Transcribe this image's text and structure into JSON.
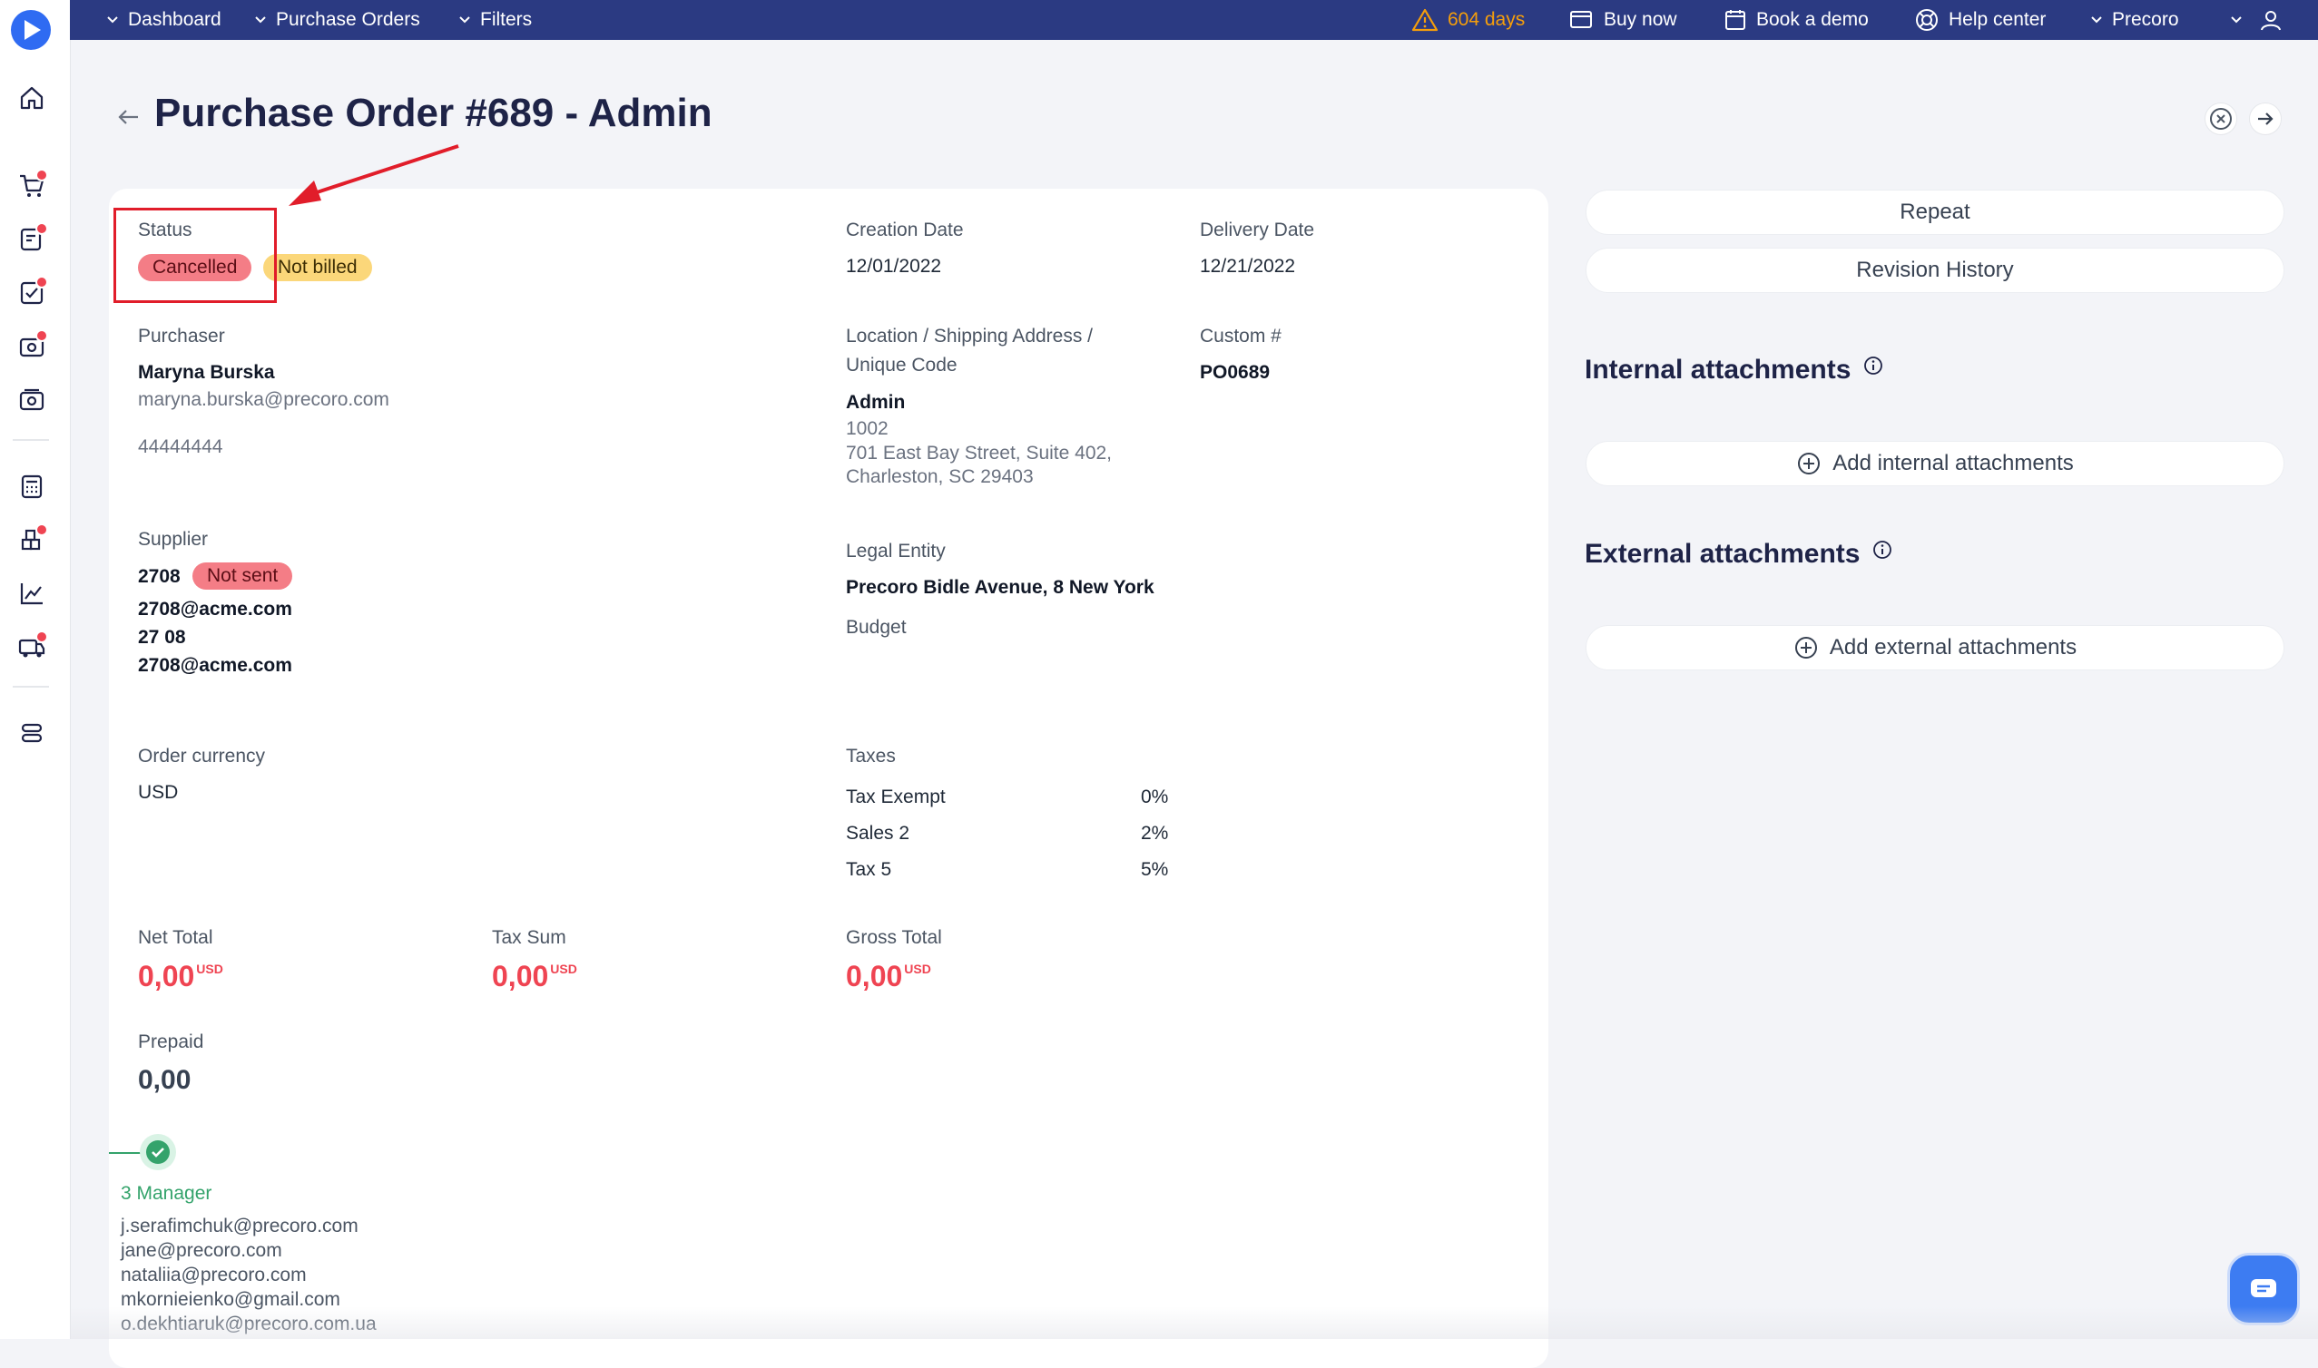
{
  "topbar": {
    "nav": [
      {
        "label": "Dashboard"
      },
      {
        "label": "Purchase Orders"
      },
      {
        "label": "Filters"
      }
    ],
    "trial_warning": "604 days",
    "buy_now": "Buy now",
    "book_demo": "Book a demo",
    "help_center": "Help center",
    "company": "Precoro"
  },
  "page": {
    "title": "Purchase Order #689 - Admin"
  },
  "order": {
    "status_label": "Status",
    "status": "Cancelled",
    "billing_status": "Not billed",
    "creation_date_label": "Creation Date",
    "creation_date": "12/01/2022",
    "delivery_date_label": "Delivery Date",
    "delivery_date": "12/21/2022",
    "purchaser_label": "Purchaser",
    "purchaser_name": "Maryna Burska",
    "purchaser_email": "maryna.burska@precoro.com",
    "purchaser_phone": "44444444",
    "location_label_1": "Location / Shipping Address /",
    "location_label_2": "Unique Code",
    "location_name": "Admin",
    "location_code": "1002",
    "location_address_1": "701 East Bay Street, Suite 402,",
    "location_address_2": "Charleston, SC 29403",
    "custom_label": "Custom #",
    "custom_value": "PO0689",
    "supplier_label": "Supplier",
    "supplier_name": "2708",
    "supplier_status": "Not sent",
    "supplier_email": "2708@acme.com",
    "supplier_contact": "27 08",
    "supplier_contact_email": "2708@acme.com",
    "legal_entity_label": "Legal Entity",
    "legal_entity": "Precoro Bidle Avenue, 8 New York",
    "budget_label": "Budget",
    "currency_label": "Order currency",
    "currency": "USD",
    "taxes_label": "Taxes",
    "taxes": [
      {
        "name": "Tax Exempt",
        "rate": "0%"
      },
      {
        "name": "Sales 2",
        "rate": "2%"
      },
      {
        "name": "Tax 5",
        "rate": "5%"
      }
    ],
    "net_total_label": "Net Total",
    "net_total": "0,00",
    "tax_sum_label": "Tax Sum",
    "tax_sum": "0,00",
    "gross_total_label": "Gross Total",
    "gross_total": "0,00",
    "currency_code": "USD",
    "prepaid_label": "Prepaid",
    "prepaid": "0,00"
  },
  "approval": {
    "step_name": "3 Manager",
    "approvers": [
      "j.serafimchuk@precoro.com",
      "jane@precoro.com",
      "nataliia@precoro.com",
      "mkornieienko@gmail.com",
      "o.dekhtiaruk@precoro.com.ua"
    ]
  },
  "side": {
    "repeat": "Repeat",
    "revision_history": "Revision History",
    "internal_title": "Internal attachments",
    "add_internal": "Add internal attachments",
    "external_title": "External attachments",
    "add_external": "Add external attachments"
  },
  "colors": {
    "topbar": "#2b3a82",
    "accent": "#2f6bf2",
    "danger": "#ef4452",
    "success": "#34a36b",
    "warning": "#f59e0b"
  },
  "icons": {
    "sidebar": [
      "home-icon",
      "cart-icon",
      "requisition-icon",
      "approval-icon",
      "receipt-icon",
      "invoice-icon",
      "calculator-icon",
      "warehouse-icon",
      "analytics-icon",
      "delivery-icon",
      "settings-toggle-icon"
    ]
  }
}
